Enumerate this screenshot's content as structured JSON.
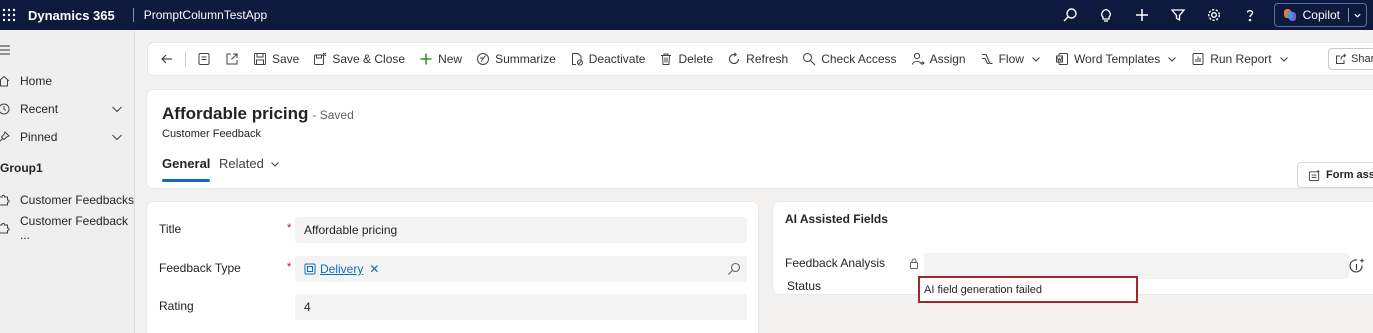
{
  "topbar": {
    "brand": "Dynamics 365",
    "app_name": "PromptColumnTestApp",
    "icons": [
      "search-icon",
      "lightbulb-icon",
      "plus-icon",
      "filter-icon",
      "gear-icon",
      "help-icon"
    ],
    "copilot_label": "Copilot"
  },
  "sidebar": {
    "items": [
      {
        "label": "Home",
        "icon": "home-icon"
      },
      {
        "label": "Recent",
        "icon": "clock-icon"
      },
      {
        "label": "Pinned",
        "icon": "pin-icon"
      }
    ],
    "group_label": "Group1",
    "group_items": [
      {
        "label": "Customer Feedbacks",
        "icon": "puzzle-icon"
      },
      {
        "label": "Customer Feedback ...",
        "icon": "puzzle-icon"
      }
    ]
  },
  "commands": {
    "save": "Save",
    "save_close": "Save & Close",
    "new": "New",
    "summarize": "Summarize",
    "deactivate": "Deactivate",
    "delete": "Delete",
    "refresh": "Refresh",
    "check_access": "Check Access",
    "assign": "Assign",
    "flow": "Flow",
    "word_templates": "Word Templates",
    "run_report": "Run Report",
    "share": "Share"
  },
  "record": {
    "title": "Affordable pricing",
    "saved_status": "- Saved",
    "entity": "Customer Feedback",
    "tabs": [
      "General",
      "Related"
    ],
    "form_assist": "Form assis"
  },
  "form": {
    "title_label": "Title",
    "title_value": "Affordable pricing",
    "feedback_type_label": "Feedback Type",
    "feedback_type_value": "Delivery",
    "rating_label": "Rating",
    "rating_value": "4",
    "required_mark": "*"
  },
  "ai_section": {
    "title": "AI Assisted Fields",
    "feedback_analysis_label": "Feedback Analysis",
    "status_label": "Status",
    "status_value": "AI field generation failed"
  },
  "colors": {
    "topbar_bg": "#0d1a3e",
    "accent": "#0f6cbd",
    "error_outline": "#a4262c",
    "required": "#c50f1f"
  }
}
